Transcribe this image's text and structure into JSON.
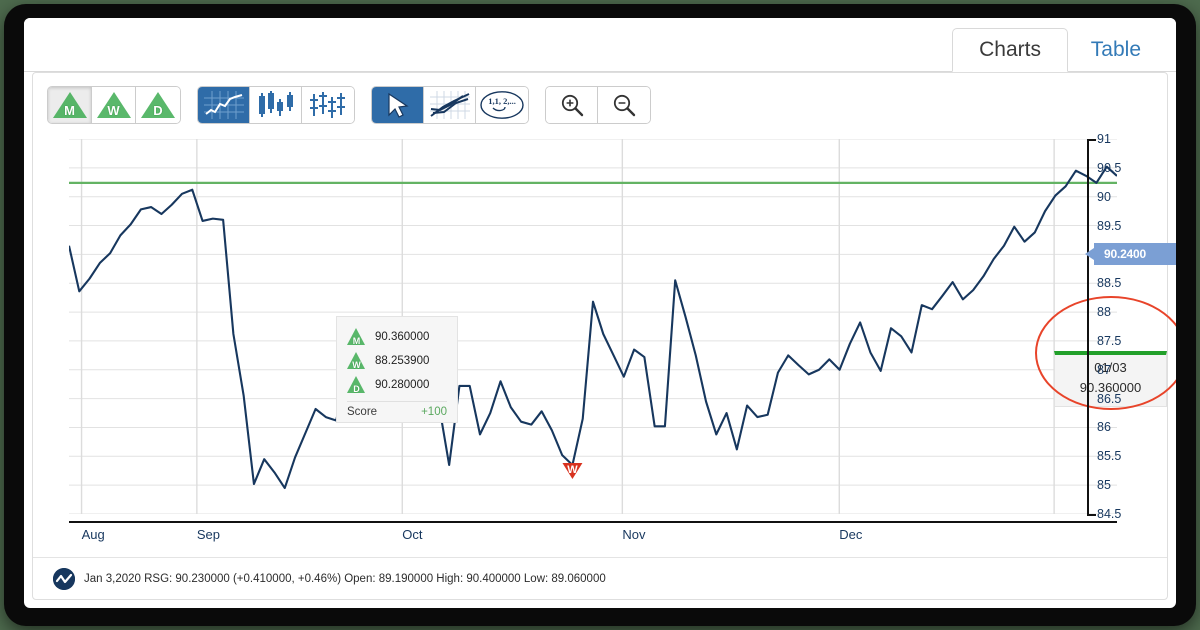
{
  "tabs": [
    {
      "id": "charts",
      "label": "Charts",
      "active": true
    },
    {
      "id": "table",
      "label": "Table",
      "active": false
    }
  ],
  "toolbar": {
    "timeframe_group": [
      {
        "name": "monthly-button",
        "glyph": "M",
        "pressed": true
      },
      {
        "name": "weekly-button",
        "glyph": "W",
        "pressed": false
      },
      {
        "name": "daily-button",
        "glyph": "D",
        "pressed": false
      }
    ],
    "chart_type_group": [
      {
        "name": "line-chart-button",
        "icon": "line-chart-icon",
        "selected": true
      },
      {
        "name": "bar-chart-button",
        "icon": "bar-chart-icon",
        "selected": false
      },
      {
        "name": "candlestick-chart-button",
        "icon": "candlestick-chart-icon",
        "selected": false
      }
    ],
    "tool_group": [
      {
        "name": "cursor-tool-button",
        "icon": "cursor-arrow-icon",
        "selected": true
      },
      {
        "name": "trendline-tool-button",
        "icon": "trendline-icon",
        "selected": false
      },
      {
        "name": "wave-count-tool-button",
        "icon": "wave-count-icon",
        "selected": false
      }
    ],
    "zoom_group": [
      {
        "name": "zoom-in-button",
        "icon": "zoom-in-icon"
      },
      {
        "name": "zoom-out-button",
        "icon": "zoom-out-icon"
      }
    ]
  },
  "legend": {
    "rows": [
      {
        "glyph": "M",
        "value": "90.360000"
      },
      {
        "glyph": "W",
        "value": "88.253900"
      },
      {
        "glyph": "D",
        "value": "90.280000"
      }
    ],
    "score_label": "Score",
    "score_value": "+100"
  },
  "tooltip": {
    "date": "01/03",
    "value": "90.360000"
  },
  "price_flag": {
    "value": "90.2400"
  },
  "status": {
    "text": "Jan 3,2020 RSG: 90.230000 (+0.410000, +0.46%) Open: 89.190000 High: 90.400000 Low: 89.060000"
  },
  "colors": {
    "series_line": "#17375e",
    "threshold_line": "#63b363",
    "marker_green": "#22a02a",
    "marker_red": "#d8321f",
    "annotation": "#e8442a",
    "flag": "#7b9fd4",
    "accent_blue": "#2f6ca8"
  },
  "chart_data": {
    "type": "line",
    "title": "",
    "xlabel": "",
    "ylabel": "",
    "ylim": [
      84.5,
      91
    ],
    "ytick_step": 0.5,
    "yticks": [
      84.5,
      85,
      85.5,
      86,
      86.5,
      87,
      87.5,
      88,
      88.5,
      89,
      89.5,
      90,
      90.5,
      91
    ],
    "xtick_labels": [
      "Aug",
      "Sep",
      "Oct",
      "Nov",
      "Dec"
    ],
    "xtick_positions": [
      0.012,
      0.122,
      0.318,
      0.528,
      0.735
    ],
    "grid": true,
    "legend_position": "inside-left",
    "threshold_line_value": 90.24,
    "annotations": [
      {
        "type": "sell-marker",
        "label": "W",
        "x_index": 49,
        "value": 85.35,
        "color": "#d8321f"
      },
      {
        "type": "buy-marker",
        "label": "M",
        "x_index": 148,
        "value": 90.24,
        "color": "#22a02a"
      },
      {
        "type": "highlight-ellipse",
        "x_index": 148
      },
      {
        "type": "crosshair-vertical",
        "x_index": 151
      }
    ],
    "series": [
      {
        "name": "RSG",
        "color": "#17375e",
        "values": [
          89.15,
          88.36,
          88.58,
          88.85,
          89.02,
          89.33,
          89.52,
          89.78,
          89.82,
          89.7,
          89.86,
          90.05,
          90.12,
          89.58,
          89.62,
          89.6,
          87.62,
          86.55,
          85.02,
          85.45,
          85.22,
          84.95,
          85.48,
          85.9,
          86.32,
          86.18,
          86.12,
          86.88,
          86.72,
          86.55,
          86.82,
          86.5,
          86.35,
          86.6,
          86.3,
          86.62,
          86.4,
          85.35,
          86.72,
          86.72,
          85.88,
          86.25,
          86.8,
          86.35,
          86.1,
          86.05,
          86.28,
          85.95,
          85.52,
          85.35,
          86.15,
          88.18,
          87.62,
          87.25,
          86.88,
          87.35,
          87.22,
          86.02,
          86.02,
          88.55,
          87.92,
          87.25,
          86.45,
          85.88,
          86.25,
          85.62,
          86.38,
          86.18,
          86.22,
          86.95,
          87.25,
          87.08,
          86.92,
          87.0,
          87.18,
          87.0,
          87.45,
          87.82,
          87.3,
          86.98,
          87.72,
          87.58,
          87.3,
          88.12,
          88.05,
          88.28,
          88.52,
          88.22,
          88.38,
          88.62,
          88.92,
          89.15,
          89.48,
          89.22,
          89.38,
          89.75,
          90.02,
          90.18,
          90.45,
          90.36,
          90.24,
          90.52,
          90.36
        ]
      }
    ]
  }
}
